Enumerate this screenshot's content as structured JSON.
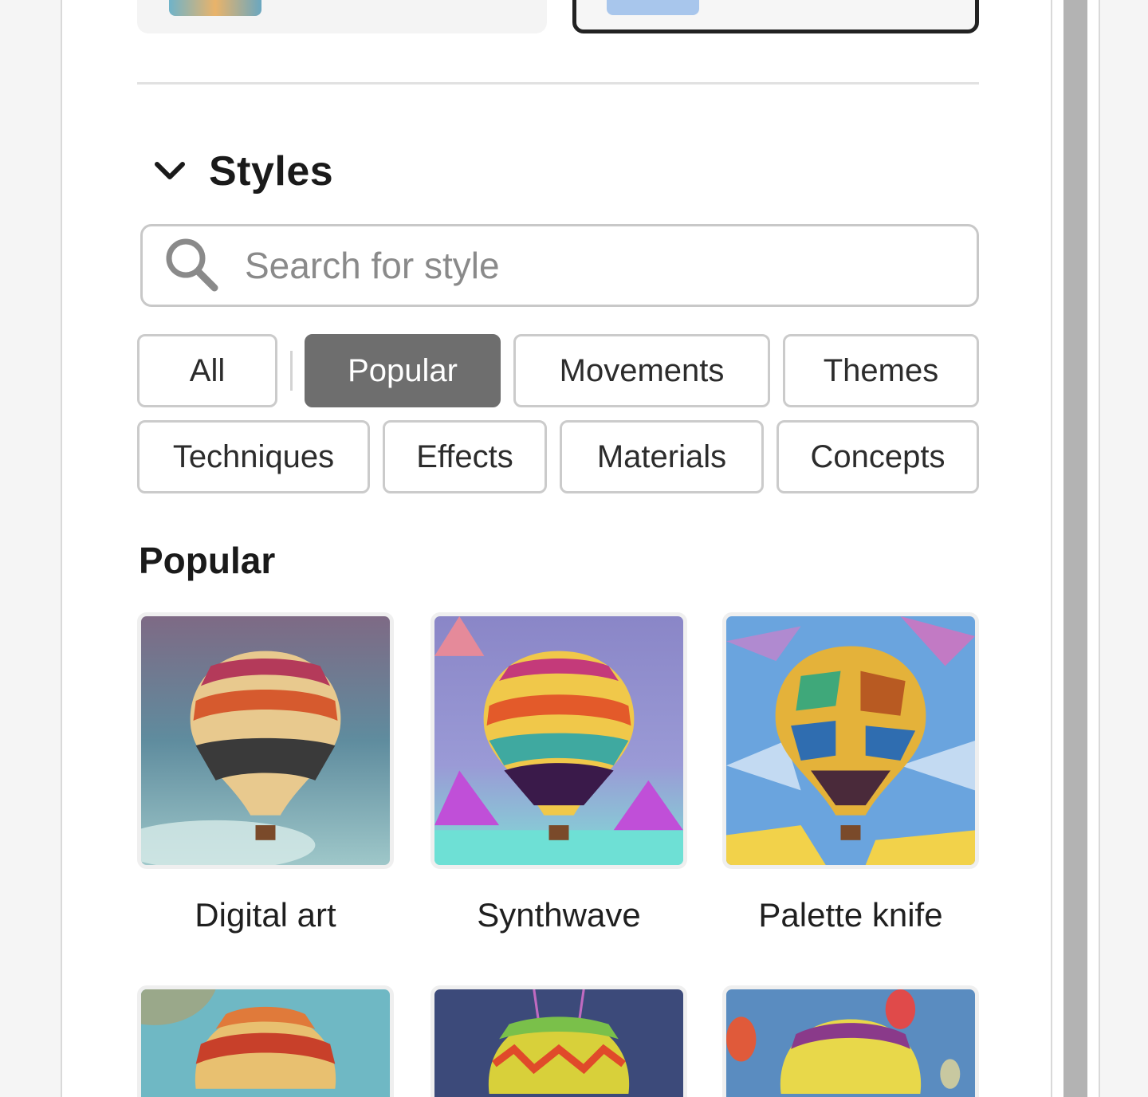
{
  "styles_section": {
    "title": "Styles",
    "search": {
      "placeholder": "Search for style",
      "value": ""
    },
    "filter_chips": [
      {
        "label": "All",
        "active": false
      },
      {
        "label": "Popular",
        "active": true
      },
      {
        "label": "Movements",
        "active": false
      },
      {
        "label": "Themes",
        "active": false
      },
      {
        "label": "Techniques",
        "active": false
      },
      {
        "label": "Effects",
        "active": false
      },
      {
        "label": "Materials",
        "active": false
      },
      {
        "label": "Concepts",
        "active": false
      }
    ],
    "group_title": "Popular",
    "tiles": [
      {
        "label": "Digital art"
      },
      {
        "label": "Synthwave"
      },
      {
        "label": "Palette knife"
      }
    ]
  },
  "icons": {
    "collapse": "chevron-down-icon",
    "search": "search-icon"
  },
  "colors": {
    "active_chip_bg": "#6e6e6e",
    "panel_bg": "#ffffff",
    "accent_border": "#222222"
  }
}
